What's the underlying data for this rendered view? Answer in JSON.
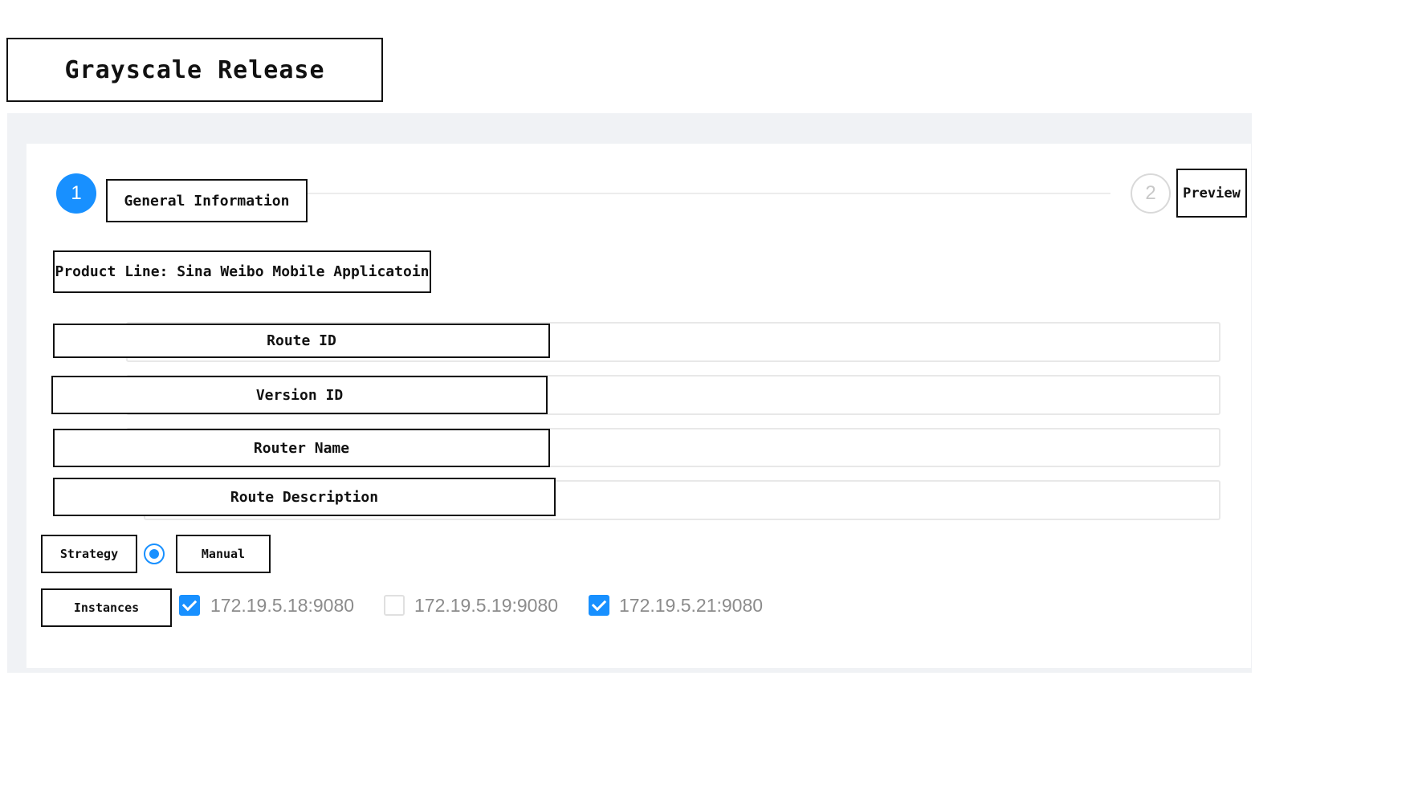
{
  "page": {
    "title": "Grayscale Release"
  },
  "steps": [
    {
      "number": "1",
      "label": "General Information",
      "state": "active"
    },
    {
      "number": "2",
      "label": "Preview",
      "state": "pending"
    }
  ],
  "product_line": "Product Line: Sina Weibo Mobile Applicatoin",
  "fields": [
    {
      "label": "Route ID",
      "value": ""
    },
    {
      "label": "Version ID",
      "value": ""
    },
    {
      "label": "Router Name",
      "value": ""
    },
    {
      "label": "Route Description",
      "value": ""
    }
  ],
  "strategy": {
    "label": "Strategy",
    "option": "Manual",
    "selected": true
  },
  "instances": {
    "label": "Instances",
    "items": [
      {
        "address": "172.19.5.18:9080",
        "checked": true
      },
      {
        "address": "172.19.5.19:9080",
        "checked": false
      },
      {
        "address": "172.19.5.21:9080",
        "checked": true
      }
    ]
  },
  "colors": {
    "accent": "#1890ff",
    "panel_background": "#f0f2f5",
    "muted_text": "#8c8c8c"
  }
}
